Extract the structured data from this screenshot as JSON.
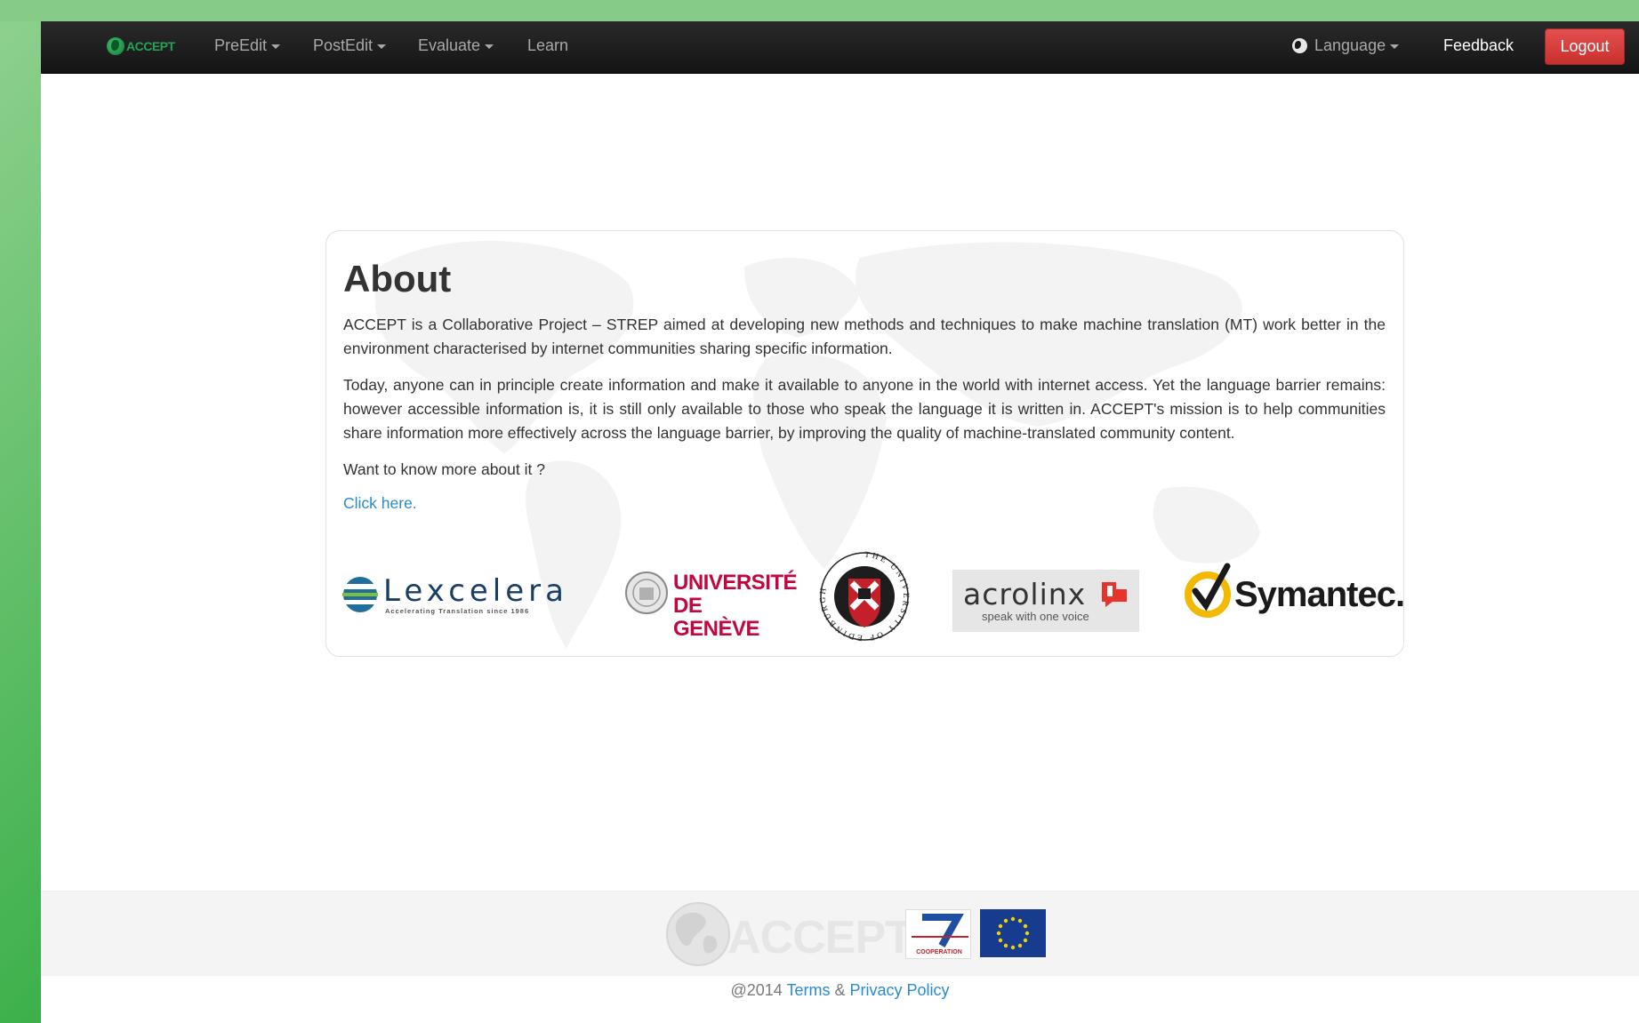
{
  "navbar": {
    "brand": "ACCEPT",
    "menus": [
      {
        "label": "PreEdit",
        "dropdown": true
      },
      {
        "label": "PostEdit",
        "dropdown": true
      },
      {
        "label": "Evaluate",
        "dropdown": true
      },
      {
        "label": "Learn",
        "dropdown": false
      }
    ],
    "language": "Language",
    "feedback": "Feedback",
    "logout": "Logout"
  },
  "about": {
    "title": "About",
    "p1": "ACCEPT is a Collaborative Project – STREP aimed at developing new methods and techniques to make machine translation (MT) work better in the environment characterised by internet communities sharing specific information.",
    "p2": "Today, anyone can in principle create information and make it available to anyone in the world with internet access. Yet the language barrier remains: however accessible information is, it is still only available to those who speak the language it is written in. ACCEPT's mission is to help communities share information more effectively across the language barrier, by improving the quality of machine-translated community content.",
    "p3": "Want to know more about it ?",
    "link": "Click here."
  },
  "partners": {
    "lexcelera": {
      "name": "Lexcelera",
      "tagline": "Accelerating Translation since 1986"
    },
    "geneve": {
      "line1": "UNIVERSITÉ",
      "line2": "DE GENÈVE"
    },
    "edinburgh": {
      "ring": "THE UNIVERSITY OF EDINBURGH"
    },
    "acrolinx": {
      "name": "acrolinx",
      "tagline": "speak with one voice"
    },
    "symantec": {
      "name": "Symantec."
    }
  },
  "footer": {
    "accept_logo": "ACCEPT",
    "fp7_label": "COOPERATION",
    "copyright": "@2014",
    "terms": "Terms",
    "amp": "&",
    "privacy": "Privacy Policy"
  },
  "colors": {
    "navbar": "#1b1b1b",
    "logout": "#d9433f",
    "link": "#2a8bcc",
    "brand_green": "#23a455",
    "desktop_green": "#2ea84a"
  }
}
